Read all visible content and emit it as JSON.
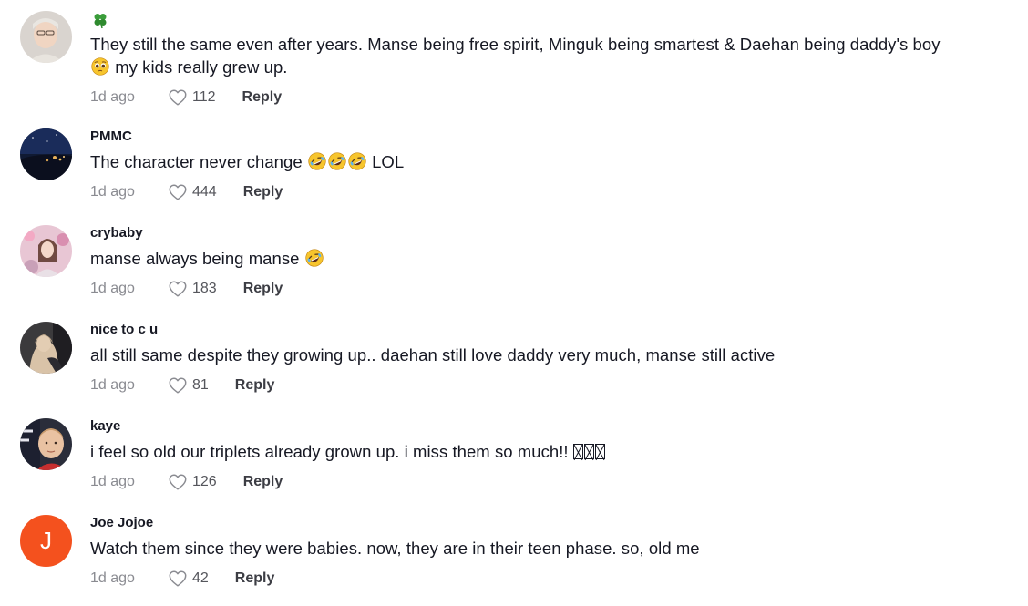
{
  "comments": [
    {
      "username": "",
      "username_icon": "four-leaf-clover-emoji",
      "text_line1": "They still the same even after years. Manse being free spirit, Minguk being smartest & Daehan being daddy's boy",
      "text_line2_emoji": "pleading-face-emoji",
      "text_line2": "my kids really grew up.",
      "time": "1d ago",
      "likes": "112",
      "reply_label": "Reply"
    },
    {
      "username": "PMMC",
      "text": "The character never change",
      "emojis": [
        "rolling-on-floor-laughing-emoji",
        "rolling-on-floor-laughing-emoji",
        "rolling-on-floor-laughing-emoji"
      ],
      "text_after": "LOL",
      "time": "1d ago",
      "likes": "444",
      "reply_label": "Reply"
    },
    {
      "username": "crybaby",
      "text": "manse always being manse",
      "emojis": [
        "rolling-on-floor-laughing-emoji"
      ],
      "time": "1d ago",
      "likes": "183",
      "reply_label": "Reply"
    },
    {
      "username": "nice to c u",
      "text": "all still same despite they growing up.. daehan still love daddy very much, manse still active",
      "time": "1d ago",
      "likes": "81",
      "reply_label": "Reply"
    },
    {
      "username": "kaye",
      "text": "i feel so old our triplets already grown up. i miss them so much!!",
      "trailing_glyphs": "missing-glyph-boxes",
      "time": "1d ago",
      "likes": "126",
      "reply_label": "Reply"
    },
    {
      "username": "Joe Jojoe",
      "avatar_letter": "J",
      "avatar_color": "#f4511e",
      "text": "Watch them since they were babies. now, they are in their teen phase. so, old me",
      "time": "1d ago",
      "likes": "42",
      "reply_label": "Reply"
    }
  ],
  "colors": {
    "text_primary": "#161823",
    "text_secondary": "#8a8b91",
    "reply": "#3c3d44",
    "avatar_letter_bg": "#f4511e"
  }
}
